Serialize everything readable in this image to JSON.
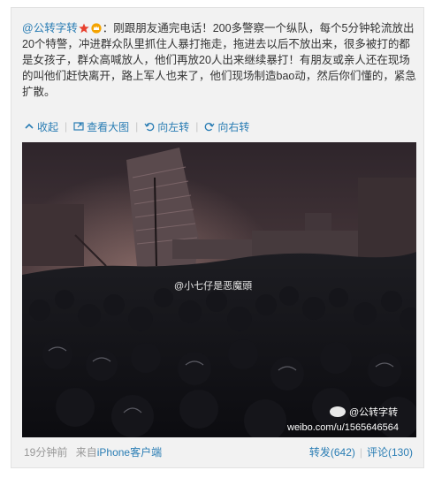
{
  "post": {
    "author": "@公转字转",
    "body": "：刚跟朋友通完电话！200多警察一个纵队，每个5分钟轮流放出20个特警，冲进群众队里抓住人暴打拖走，拖进去以后不放出来，很多被打的都是女孩子，群众高喊放人，他们再放20人出来继续暴打！有朋友或亲人还在现场的叫他们赶快离开，路上军人也来了，他们现场制造bao动，然后你们懂的，紧急扩散。"
  },
  "actions": {
    "collapse": "收起",
    "view_large": "查看大图",
    "rotate_left": "向左转",
    "rotate_right": "向右转"
  },
  "photo": {
    "overlay_author": "@小七仔是恶魔頭",
    "watermark_user": "@公转字转",
    "watermark_url": "weibo.com/u/1565646564"
  },
  "footer": {
    "time": "19分钟前",
    "source_prefix": "来自",
    "source": "iPhone客户端",
    "repost": "转发(642)",
    "divider": "|",
    "comment": "评论(130)"
  },
  "colors": {
    "link": "#2a7db4",
    "card_bg": "#f2f2f2"
  }
}
